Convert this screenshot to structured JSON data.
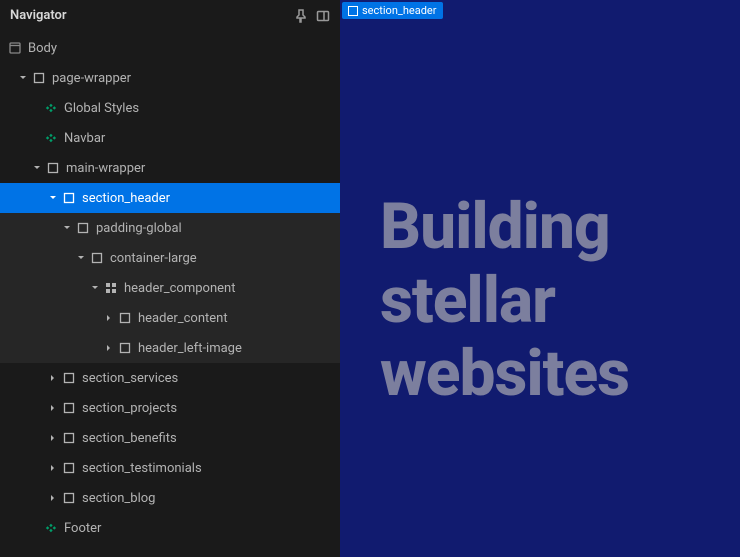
{
  "panel": {
    "title": "Navigator"
  },
  "tree": {
    "body": "Body",
    "pageWrapper": "page-wrapper",
    "globalStyles": "Global Styles",
    "navbar": "Navbar",
    "mainWrapper": "main-wrapper",
    "sectionHeader": "section_header",
    "paddingGlobal": "padding-global",
    "containerLarge": "container-large",
    "headerComponent": "header_component",
    "headerContent": "header_content",
    "headerLeftImage": "header_left-image",
    "sectionServices": "section_services",
    "sectionProjects": "section_projects",
    "sectionBenefits": "section_benefits",
    "sectionTestimonials": "section_testimonials",
    "sectionBlog": "section_blog",
    "footer": "Footer"
  },
  "canvas": {
    "selectedTag": "section_header",
    "heroLine1": "Building",
    "heroLine2": "stellar",
    "heroLine3": "websites"
  }
}
